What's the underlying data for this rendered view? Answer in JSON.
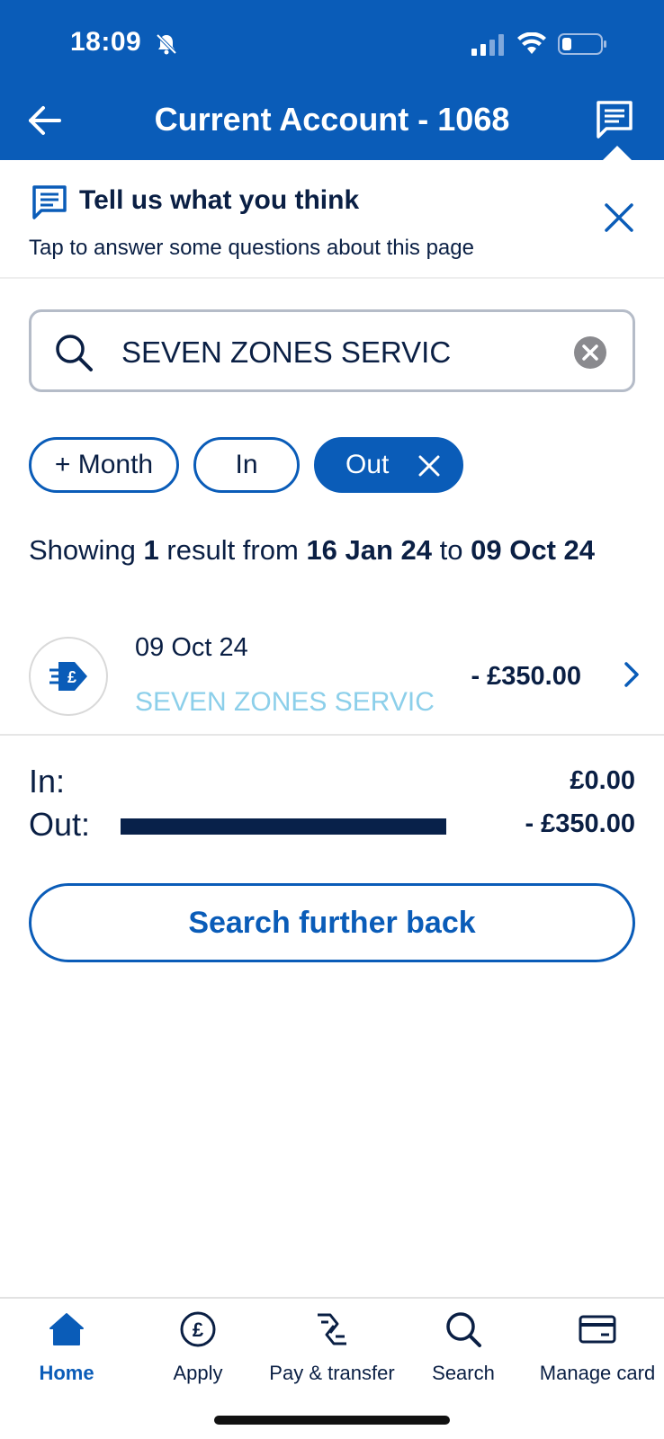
{
  "status_bar": {
    "time": "18:09"
  },
  "header": {
    "title": "Current Account - 1068"
  },
  "feedback": {
    "title": "Tell us what you think",
    "subtitle": "Tap to answer some questions about this page"
  },
  "search": {
    "value": "SEVEN ZONES SERVIC"
  },
  "filters": {
    "month_label": "+ Month",
    "in_label": "In",
    "out_label": "Out"
  },
  "summary_text": {
    "prefix": "Showing ",
    "count": "1",
    "middle": " result from ",
    "from_date": "16 Jan 24",
    "to_word": " to ",
    "to_date": "09 Oct 24"
  },
  "transactions": [
    {
      "date": "09 Oct 24",
      "name": "SEVEN ZONES SERVIC",
      "amount": "- £350.00"
    }
  ],
  "totals": {
    "in_label": "In:",
    "in_value": "£0.00",
    "out_label": "Out:",
    "out_value": "- £350.00",
    "out_bar_fraction": 1.0
  },
  "actions": {
    "search_further_back": "Search further back"
  },
  "tabbar": {
    "items": [
      {
        "label": "Home",
        "icon": "home-icon"
      },
      {
        "label": "Apply",
        "icon": "pound-circle-icon"
      },
      {
        "label": "Pay & transfer",
        "icon": "pay-transfer-icon"
      },
      {
        "label": "Search",
        "icon": "search-icon"
      },
      {
        "label": "Manage card",
        "icon": "card-icon"
      }
    ]
  },
  "colors": {
    "brand_blue": "#0a5cb8",
    "dark_navy": "#0a1f44",
    "merchant_text": "#8ccfea",
    "out_bar": "#08214a"
  }
}
